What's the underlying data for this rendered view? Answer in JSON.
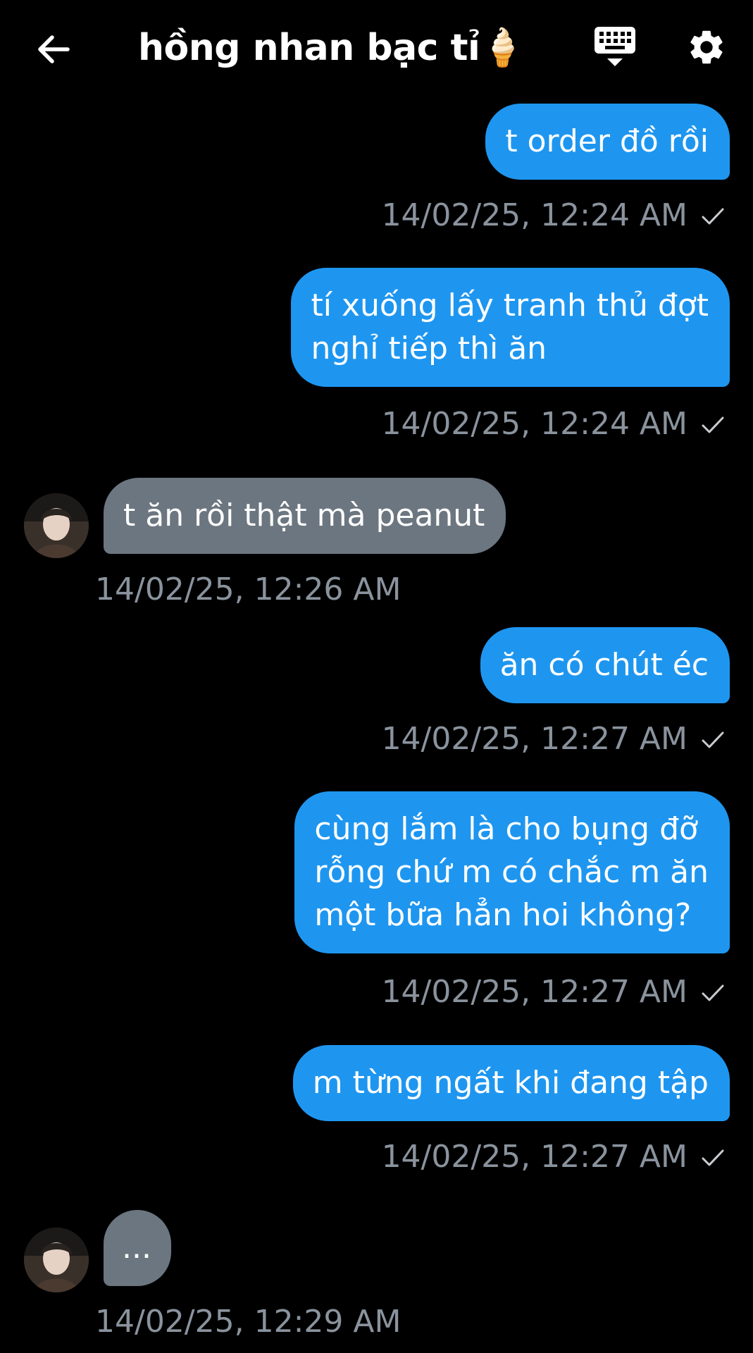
{
  "header": {
    "title": "hồng nhan bạc tỉ🍦",
    "back_icon": "arrow-left-icon",
    "keyboard_icon": "keyboard-hide-icon",
    "settings_icon": "gear-icon"
  },
  "colors": {
    "background": "#000000",
    "outgoing_bubble": "#1e96f0",
    "incoming_bubble": "#6c7680",
    "timestamp": "#8a939d",
    "text": "#ffffff"
  },
  "messages": [
    {
      "direction": "out",
      "text": "t order đồ rồi",
      "time": "14/02/25, 12:24 AM",
      "status": "sent"
    },
    {
      "direction": "out",
      "text": "tí xuống lấy tranh thủ đợt\nnghỉ tiếp thì ăn",
      "time": "14/02/25, 12:24 AM",
      "status": "sent"
    },
    {
      "direction": "in",
      "text": "t ăn rồi thật mà peanut",
      "time": "14/02/25, 12:26 AM"
    },
    {
      "direction": "out",
      "text": "ăn có chút éc",
      "time": "14/02/25, 12:27 AM",
      "status": "sent"
    },
    {
      "direction": "out",
      "text": "cùng lắm là cho bụng đỡ\nrỗng chứ m có chắc m ăn\nmột bữa hẳn hoi không?",
      "time": "14/02/25, 12:27 AM",
      "status": "sent"
    },
    {
      "direction": "out",
      "text": "m từng ngất khi đang tập",
      "time": "14/02/25, 12:27 AM",
      "status": "sent"
    },
    {
      "direction": "in",
      "text": "...",
      "time": "14/02/25, 12:29 AM"
    }
  ]
}
